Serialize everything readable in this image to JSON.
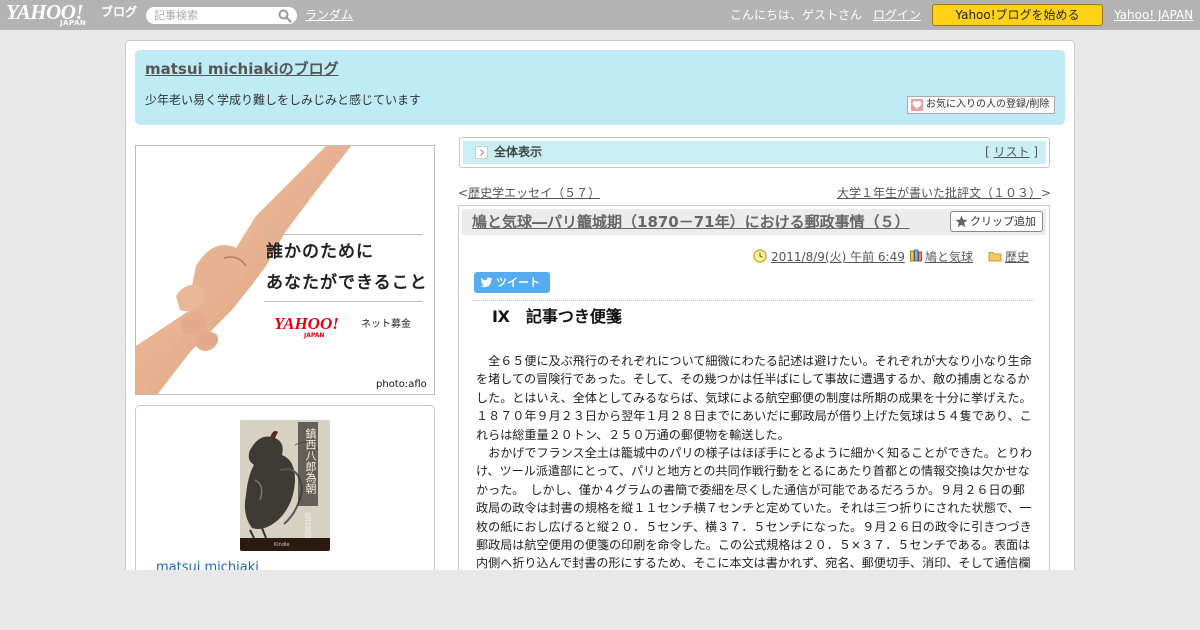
{
  "topbar": {
    "logo_main": "YAHOO!",
    "logo_sub": "JAPAN",
    "logo_blog": "ブログ",
    "search_placeholder": "記事検索",
    "random_link": "ランダム",
    "greeting": "こんにちは、ゲストさん",
    "login_link": "ログイン",
    "start_button": "Yahoo!ブログを始める",
    "yahoo_japan_link": "Yahoo! JAPAN"
  },
  "header": {
    "blog_title": "matsui michiakiのブログ",
    "blog_description": "少年老い易く学成り難しをしみじみと感じています",
    "fav_button": "お気に入りの人の登録/削除"
  },
  "ad": {
    "line1": "誰かのために",
    "line2": "あなたができること",
    "logo": "YAHOO!",
    "logo_sub": "JAPAN",
    "service": "ネット募金",
    "credit": "photo:aflo"
  },
  "profile": {
    "book_title": "鎮西八郎為朝",
    "book_author": "松井道昭",
    "book_brand": "Kindle",
    "name": "matsui michiaki"
  },
  "allbar": {
    "label": "全体表示",
    "list_prefix": "[ ",
    "list_link": "リスト",
    "list_suffix": " ]"
  },
  "pager": {
    "prev_prefix": "<",
    "prev": "歴史学エッセイ（５７）",
    "next": "大学１年生が書いた批評文（１０３）",
    "next_suffix": ">"
  },
  "article": {
    "title": "鳩と気球―パリ籠城期（1870－71年）における郵政事情（５）",
    "clip_button": "クリップ追加",
    "datetime": "2011/8/9(火) 午前 6:49",
    "category1": "鳩と気球",
    "category2": "歴史",
    "tweet_button": "ツイート",
    "section_heading": "Ⅸ　記事つき便箋",
    "paragraphs": [
      "　全６５便に及ぶ飛行のそれぞれについて細微にわたる記述は避けたい。それぞれが大なり小なり生命を堵しての冒険行であった。そして、その幾つかは任半ばにして事故に遭遇するか、敵の捕虜となるかした。とはいえ、全体としてみるならば、気球による航空郵便の制度は所期の成果を十分に挙げえた。１８７０年９月２３日から翌年１月２８日までにあいだに郵政局が借り上げた気球は５４隻であり、これらは総重量２０トン、２５０万通の郵便物を輸送した。",
      "　おかげでフランス全土は籠城中のパリの様子はほぼ手にとるように細かく知ることができた。とりわけ、ツール派遣部にとって、パリと地方との共同作戦行動をとるにあたり首都との情報交換は欠かせなかった。　しかし、僅か４グラムの書簡で委細を尽くした通信が可能であるだろうか。９月２６日の郵政局の政令は封書の規格を縦１１センチ横７センチと定めていた。それは三つ折りにされた状態で、一枚の紙におし広げると縦２０．５センチ、横３７．５センチになった。９月２６日の政令に引きつづき郵政局は航空便用の便箋の印刷を命令した。この公式規格は２０．５×３７．５センチである。表面は内側へ折り込んで封書の形にするため、そこに本文は書かれず、宛名、郵便切手、消印、そして通信欄が記されていた。中は全文書く場所で、右上に記事つきである。"
    ]
  }
}
